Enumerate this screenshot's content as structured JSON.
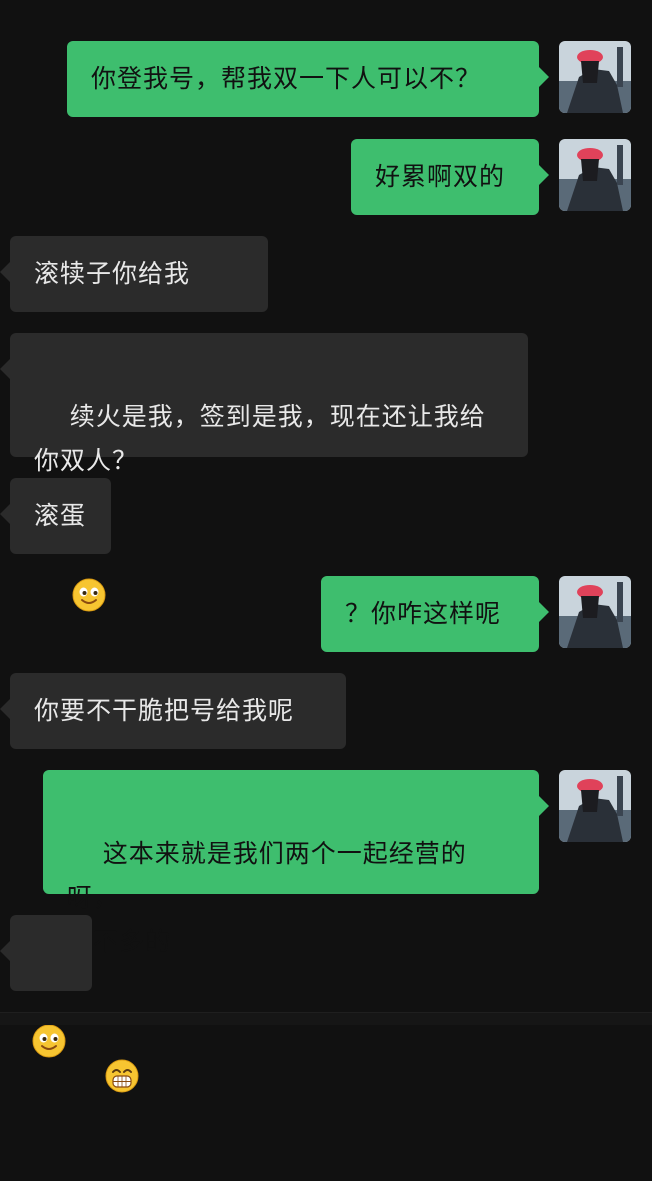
{
  "messages": [
    {
      "side": "me",
      "text": "你登我号，帮我双一下人可以不？",
      "emoji": ""
    },
    {
      "side": "me",
      "text": "好累啊双的",
      "emoji": ""
    },
    {
      "side": "them",
      "text": "滚犊子你给我",
      "emoji": "smile-emoji"
    },
    {
      "side": "them",
      "text": "续火是我，签到是我，现在还让我给\n你双人？",
      "emoji": "smile-emoji"
    },
    {
      "side": "them",
      "text": "滚蛋",
      "emoji": ""
    },
    {
      "side": "me",
      "text": "？你咋这样呢",
      "emoji": ""
    },
    {
      "side": "them",
      "text": "你要不干脆把号给我呢",
      "emoji": ""
    },
    {
      "side": "me",
      "text": "这本来就是我们两个一起经营的呀，\n差不多的",
      "emoji": "grimace-emoji"
    },
    {
      "side": "them",
      "text": "",
      "emoji": "smile-emoji"
    }
  ],
  "colors": {
    "background": "#111111",
    "my_bubble": "#3ebe6e",
    "their_bubble": "#2b2b2b",
    "their_text": "#e8e8e8"
  }
}
